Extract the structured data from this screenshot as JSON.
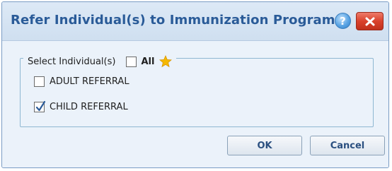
{
  "dialog": {
    "title": "Refer Individual(s) to Immunization Program",
    "help_icon": "help-question-icon",
    "close_icon": "close-x-icon"
  },
  "selection": {
    "legend": "Select Individual(s)",
    "all_label": "All",
    "all_checked": false,
    "favorite_icon": "star-icon",
    "favorite_color": "#f5b800",
    "items": [
      {
        "label": "ADULT REFERRAL",
        "checked": false
      },
      {
        "label": "CHILD REFERRAL",
        "checked": true
      }
    ]
  },
  "buttons": {
    "ok": "OK",
    "cancel": "Cancel"
  },
  "colors": {
    "title": "#2a5b98",
    "close": "#d9422c",
    "help": "#5aa4e4"
  }
}
